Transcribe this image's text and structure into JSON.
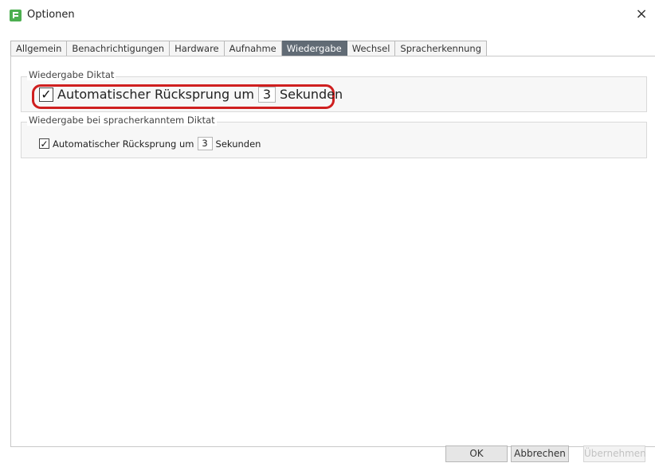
{
  "window": {
    "title": "Optionen",
    "close": "×"
  },
  "tabs": [
    {
      "label": "Allgemein"
    },
    {
      "label": "Benachrichtigungen"
    },
    {
      "label": "Hardware"
    },
    {
      "label": "Aufnahme"
    },
    {
      "label": "Wiedergabe",
      "active": true
    },
    {
      "label": "Wechsel"
    },
    {
      "label": "Spracherkennung"
    }
  ],
  "sections": [
    {
      "title": "Wiedergabe Diktat",
      "checkbox_label": "Automatischer Rücksprung um",
      "seconds": "3",
      "unit": "Sekunden",
      "checked": true,
      "check_mark": "✓"
    },
    {
      "title": "Wiedergabe bei spracherkanntem Diktat",
      "checkbox_label": "Automatischer Rücksprung um",
      "seconds": "3",
      "unit": "Sekunden",
      "checked": true,
      "check_mark": "✓"
    }
  ],
  "buttons": {
    "ok": "OK",
    "cancel": "Abbrechen",
    "apply": "Übernehmen"
  },
  "colors": {
    "highlight": "#cf1f1f",
    "active_tab": "#616b75",
    "app_icon": "#4caf50"
  },
  "icons": {
    "app": "app-icon",
    "close": "close-icon",
    "checkbox": "checkbox-checked-icon"
  }
}
